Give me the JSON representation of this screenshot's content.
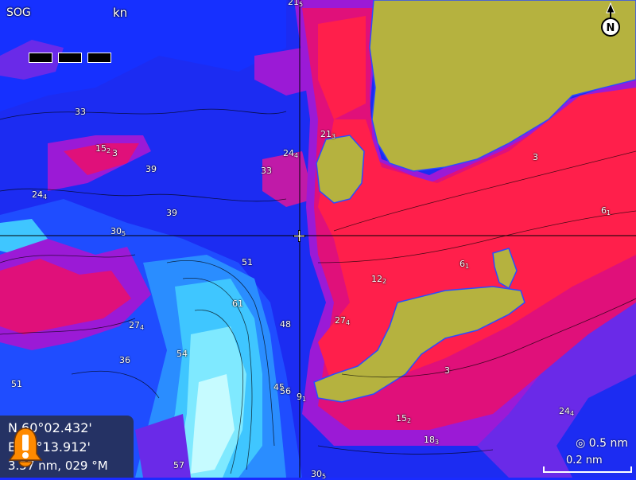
{
  "hud": {
    "sog_label": "SOG",
    "sog_unit": "kn",
    "compass_letter": "N"
  },
  "position_box": {
    "latitude": "N 60°02.432'",
    "longitude": "E 10°13.912'",
    "range_bearing": "3.57 nm, 029 °M"
  },
  "range_ring": "0.5 nm",
  "scale_label": "0.2 nm",
  "depth_labels": [
    {
      "main": "21",
      "sub": "5"
    },
    {
      "main": "33",
      "sub": ""
    },
    {
      "main": "15",
      "sub": "2"
    },
    {
      "main": "3",
      "sub": ""
    },
    {
      "main": "39",
      "sub": ""
    },
    {
      "main": "24",
      "sub": "4"
    },
    {
      "main": "39",
      "sub": ""
    },
    {
      "main": "30",
      "sub": "5"
    },
    {
      "main": "33",
      "sub": ""
    },
    {
      "main": "24",
      "sub": "4"
    },
    {
      "main": "21",
      "sub": "3"
    },
    {
      "main": "3",
      "sub": ""
    },
    {
      "main": "6",
      "sub": "1"
    },
    {
      "main": "51",
      "sub": ""
    },
    {
      "main": "6",
      "sub": "1"
    },
    {
      "main": "12",
      "sub": "2"
    },
    {
      "main": "61",
      "sub": ""
    },
    {
      "main": "27",
      "sub": "4"
    },
    {
      "main": "48",
      "sub": ""
    },
    {
      "main": "27",
      "sub": "4"
    },
    {
      "main": "54",
      "sub": ""
    },
    {
      "main": "36",
      "sub": ""
    },
    {
      "main": "51",
      "sub": ""
    },
    {
      "main": "3",
      "sub": ""
    },
    {
      "main": "45",
      "sub": ""
    },
    {
      "main": "56",
      "sub": ""
    },
    {
      "main": "9",
      "sub": "1"
    },
    {
      "main": "15",
      "sub": "2"
    },
    {
      "main": "24",
      "sub": "4"
    },
    {
      "main": "18",
      "sub": "3"
    },
    {
      "main": "57",
      "sub": ""
    },
    {
      "main": "30",
      "sub": "5"
    }
  ],
  "colors": {
    "land": "#b5b23f",
    "shallow": "#ff1f4b",
    "mid": "#e0107a",
    "deep": "#1a2bff",
    "deepest": "#7be8ff"
  }
}
